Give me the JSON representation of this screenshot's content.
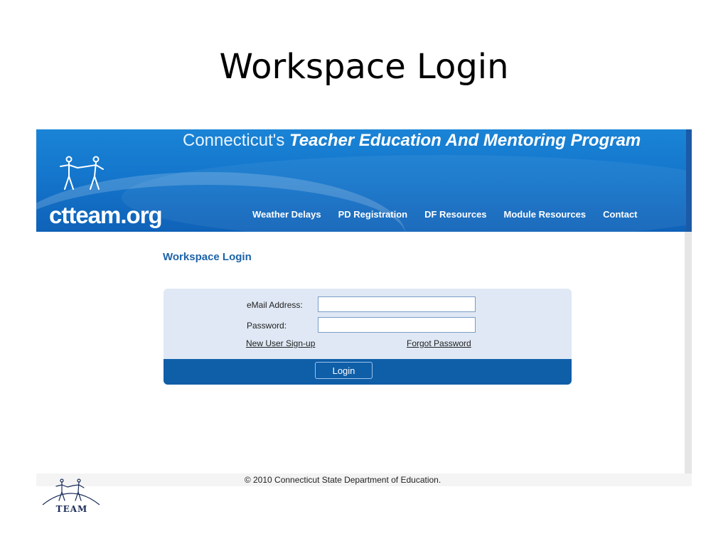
{
  "slide": {
    "title": "Workspace Login"
  },
  "banner": {
    "title_prefix": "Connecticut's ",
    "title_emphasis": "Teacher Education And Mentoring Program",
    "site_name": "ctteam.org"
  },
  "nav": {
    "items": [
      "Weather Delays",
      "PD Registration",
      "DF Resources",
      "Module Resources",
      "Contact"
    ]
  },
  "main": {
    "heading": "Workspace Login"
  },
  "form": {
    "email_label": "eMail Address:",
    "email_value": "",
    "password_label": "Password:",
    "password_value": "",
    "signup_link": "New User Sign-up",
    "forgot_link": "Forgot Password",
    "login_button": "Login"
  },
  "footer": {
    "copyright": "© 2010 Connecticut State Department of Education."
  },
  "team_logo": {
    "text": "TEAM"
  },
  "colors": {
    "banner_blue": "#1476cc",
    "form_bar": "#0f5ea8",
    "heading_blue": "#1e63a8",
    "form_background": "#dfe8f4"
  }
}
